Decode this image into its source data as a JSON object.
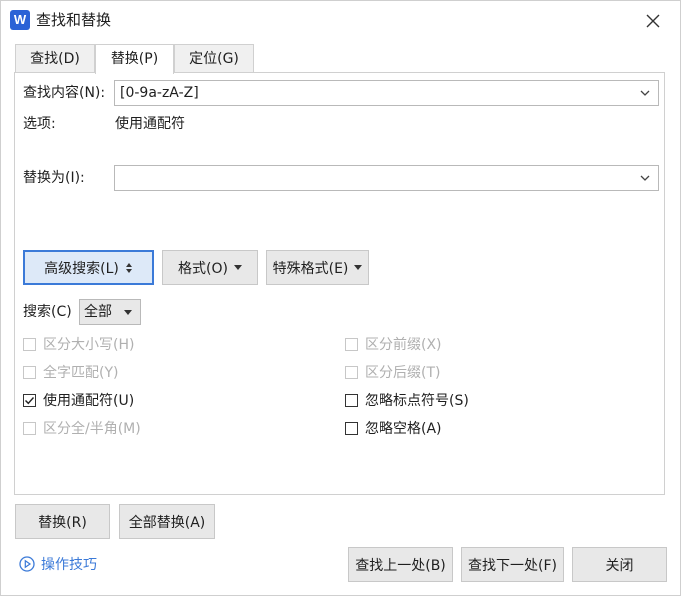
{
  "window": {
    "title": "查找和替换",
    "app_icon_letter": "W",
    "accent_color": "#3b7ad8"
  },
  "tabs": [
    {
      "label": "查找(D)",
      "active": false
    },
    {
      "label": "替换(P)",
      "active": true
    },
    {
      "label": "定位(G)",
      "active": false
    }
  ],
  "find": {
    "label": "查找内容(N):",
    "value": "[0-9a-zA-Z]",
    "options_label": "选项:",
    "options_value": "使用通配符"
  },
  "replace": {
    "label": "替换为(I):",
    "value": ""
  },
  "buttons": {
    "advanced": "高级搜索(L)",
    "format": "格式(O)",
    "special": "特殊格式(E)",
    "replace": "替换(R)",
    "replace_all": "全部替换(A)",
    "find_prev": "查找上一处(B)",
    "find_next": "查找下一处(F)",
    "close": "关闭"
  },
  "search": {
    "label": "搜索(C)",
    "value": "全部"
  },
  "options": [
    {
      "label": "区分大小写(H)",
      "checked": false,
      "enabled": false
    },
    {
      "label": "区分前缀(X)",
      "checked": false,
      "enabled": false
    },
    {
      "label": "全字匹配(Y)",
      "checked": false,
      "enabled": false
    },
    {
      "label": "区分后缀(T)",
      "checked": false,
      "enabled": false
    },
    {
      "label": "使用通配符(U)",
      "checked": true,
      "enabled": true
    },
    {
      "label": "忽略标点符号(S)",
      "checked": false,
      "enabled": true
    },
    {
      "label": "区分全/半角(M)",
      "checked": false,
      "enabled": false
    },
    {
      "label": "忽略空格(A)",
      "checked": false,
      "enabled": true
    }
  ],
  "footer": {
    "tips_label": "操作技巧"
  }
}
